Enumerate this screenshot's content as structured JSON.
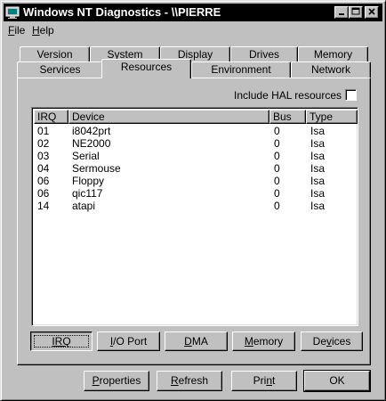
{
  "window": {
    "title": "Windows NT Diagnostics - \\\\PIERRE",
    "minimize_icon": "minimize-icon",
    "maximize_icon": "maximize-icon",
    "close_icon": "close-icon"
  },
  "menu": {
    "file_hot": "F",
    "file_rest": "ile",
    "help_hot": "H",
    "help_rest": "elp"
  },
  "tabs": {
    "row1": [
      "Version",
      "System",
      "Display",
      "Drives",
      "Memory"
    ],
    "row2": [
      "Services",
      "Resources",
      "Environment",
      "Network"
    ],
    "active": "Resources"
  },
  "hal": {
    "label": "Include HAL resources",
    "checked": false
  },
  "table": {
    "columns": [
      "IRQ",
      "Device",
      "Bus",
      "Type"
    ],
    "rows": [
      [
        "01",
        "i8042prt",
        "0",
        "Isa"
      ],
      [
        "02",
        "NE2000",
        "0",
        "Isa"
      ],
      [
        "03",
        "Serial",
        "0",
        "Isa"
      ],
      [
        "04",
        "Sermouse",
        "0",
        "Isa"
      ],
      [
        "06",
        "Floppy",
        "0",
        "Isa"
      ],
      [
        "06",
        "qic117",
        "0",
        "Isa"
      ],
      [
        "14",
        "atapi",
        "0",
        "Isa"
      ]
    ]
  },
  "view_buttons": {
    "irq": "IRQ",
    "io_port_hot": "I",
    "io_port_rest": "/O Port",
    "dma_hot": "D",
    "dma_rest": "MA",
    "memory_hot": "M",
    "memory_rest": "emory",
    "devices_pre": "De",
    "devices_hot": "v",
    "devices_rest": "ices"
  },
  "footer_buttons": {
    "properties_hot": "P",
    "properties_rest": "roperties",
    "refresh_hot": "R",
    "refresh_rest": "efresh",
    "print_pre": "Pri",
    "print_hot": "n",
    "print_rest": "t",
    "ok": "OK"
  }
}
